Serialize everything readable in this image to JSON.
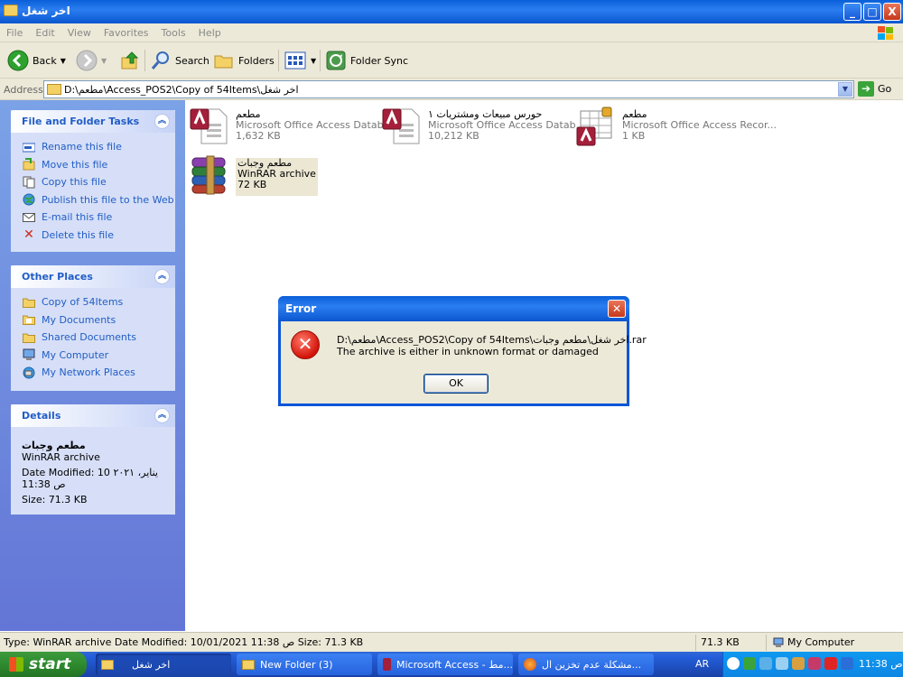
{
  "window": {
    "title": "اخر شغل",
    "buttons": {
      "minimize": "_",
      "maximize": "□",
      "close": "X"
    }
  },
  "menu": {
    "items": [
      "File",
      "Edit",
      "View",
      "Favorites",
      "Tools",
      "Help"
    ]
  },
  "toolbar": {
    "back": "Back",
    "search": "Search",
    "folders": "Folders",
    "folder_sync": "Folder Sync"
  },
  "address": {
    "label": "Address",
    "path": "D:\\مطعم\\Access_POS2\\Copy of 54Items\\اخر شغل",
    "go": "Go"
  },
  "left_pane": {
    "tasks": {
      "title": "File and Folder Tasks",
      "items": [
        "Rename this file",
        "Move this file",
        "Copy this file",
        "Publish this file to the Web",
        "E-mail this file",
        "Delete this file"
      ]
    },
    "places": {
      "title": "Other Places",
      "items": [
        "Copy of 54Items",
        "My Documents",
        "Shared Documents",
        "My Computer",
        "My Network Places"
      ]
    },
    "details": {
      "title": "Details",
      "name": "مطعم وجبات",
      "type": "WinRAR archive",
      "date_line1": "Date Modified: 10 يناير، ٢٠٢١",
      "date_line2": "11:38 ص",
      "size": "Size: 71.3 KB"
    }
  },
  "files": [
    {
      "name": "مطعم",
      "type": "Microsoft Office Access Datab...",
      "size": "1,632 KB"
    },
    {
      "name": "حورس مبيعات ومشتريات ١",
      "type": "Microsoft Office Access Datab...",
      "size": "10,212 KB"
    },
    {
      "name": "مطعم",
      "type": "Microsoft Office Access Recor...",
      "size": "1 KB"
    },
    {
      "name": "مطعم وجبات",
      "type": "WinRAR archive",
      "size": "72 KB"
    }
  ],
  "dialog": {
    "title": "Error",
    "line1": "D:\\مطعم\\Access_POS2\\Copy of 54Items\\اخر شغل\\مطعم وجبات.rar",
    "line2": "The archive is either in unknown format or damaged",
    "ok": "OK"
  },
  "statusbar": {
    "info": "Type: WinRAR archive Date Modified: 10/01/2021 11:38 ص Size: 71.3 KB",
    "size": "71.3 KB",
    "location": "My Computer"
  },
  "taskbar": {
    "start": "start",
    "buttons": [
      "اخر شغل",
      "New Folder (3)",
      "Microsoft Access - مط...",
      "مشكلة عدم تخزين ال..."
    ],
    "lang": "AR",
    "clock": "ص 11:38"
  }
}
